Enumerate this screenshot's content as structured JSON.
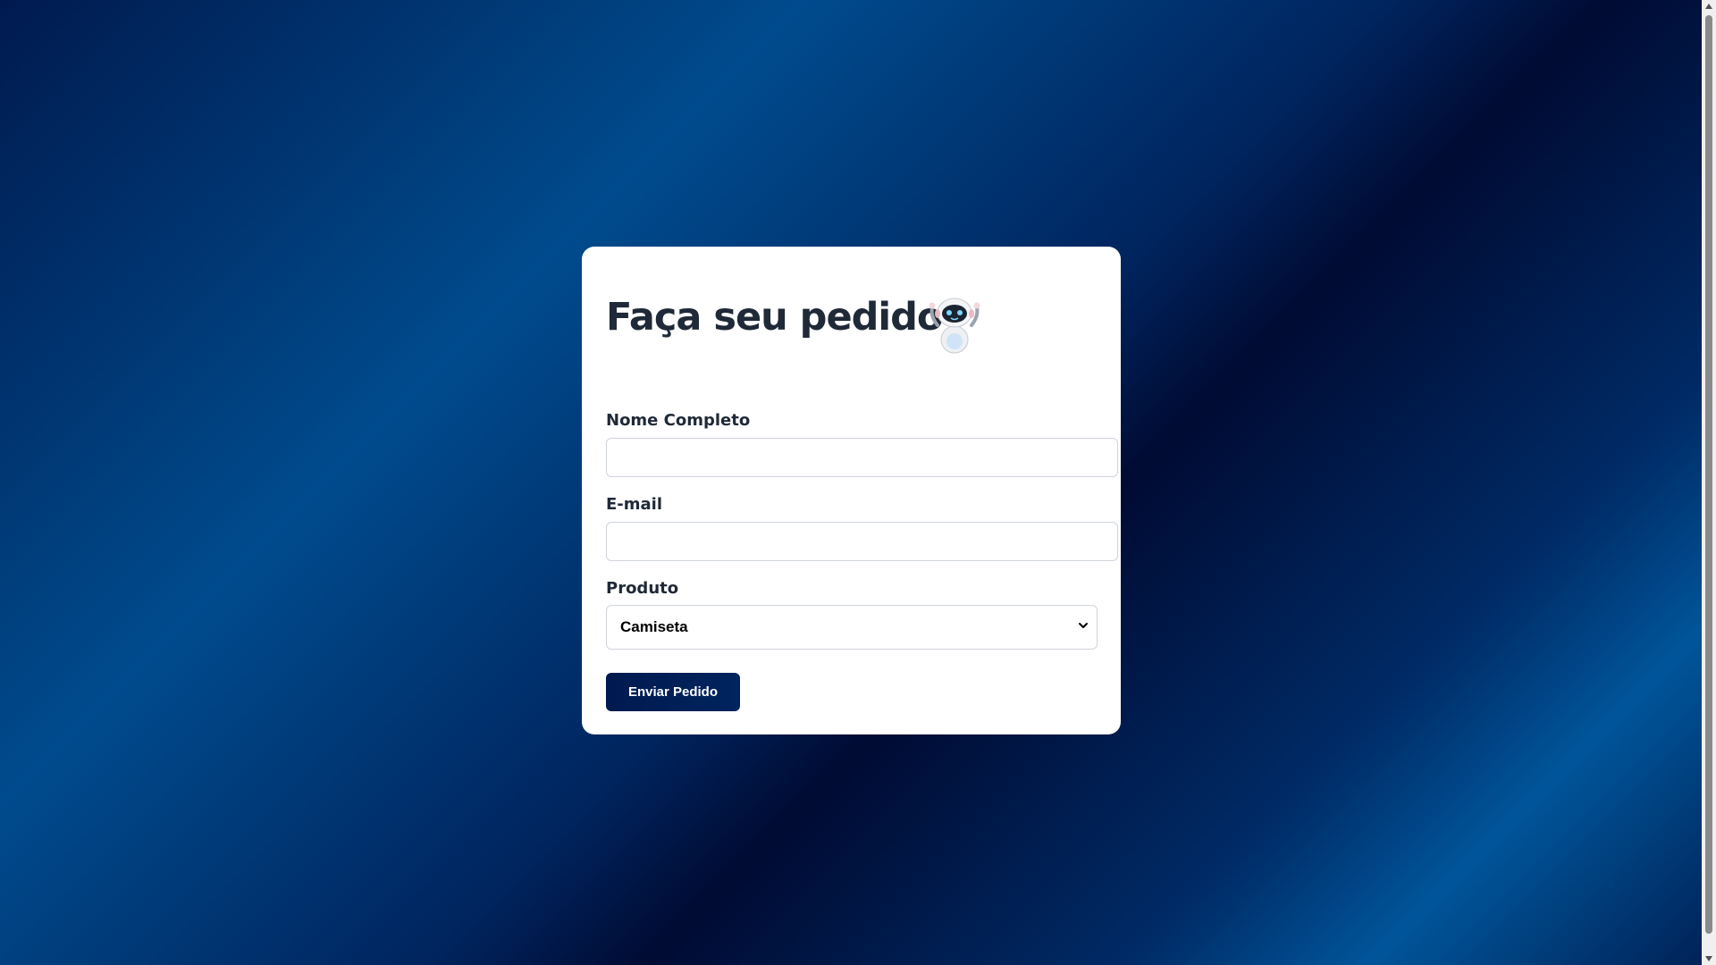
{
  "form": {
    "title": "Faça seu pedido",
    "name_label": "Nome Completo",
    "name_value": "",
    "email_label": "E-mail",
    "email_value": "",
    "product_label": "Produto",
    "product_selected": "Camiseta",
    "submit_label": "Enviar Pedido"
  },
  "icons": {
    "mascot": "robot-icon",
    "select_arrow": "chevron-down-icon"
  },
  "colors": {
    "card": "#ffffff",
    "title": "#1f2937",
    "button": "#001a4f",
    "background": "#004b8d"
  }
}
